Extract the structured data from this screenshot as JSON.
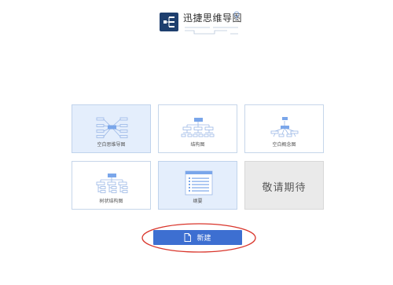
{
  "app": {
    "title": "迅捷思维导图"
  },
  "templates": [
    {
      "label": "空白思维导图",
      "icon": "mindmap-thumbnail-icon",
      "state": "selected"
    },
    {
      "label": "结构图",
      "icon": "structure-chart-thumbnail-icon",
      "state": "normal"
    },
    {
      "label": "空白概念图",
      "icon": "concept-map-thumbnail-icon",
      "state": "normal"
    },
    {
      "label": "树状结构图",
      "icon": "tree-chart-thumbnail-icon",
      "state": "normal"
    },
    {
      "label": "纲要",
      "icon": "outline-thumbnail-icon",
      "state": "selected"
    },
    {
      "label": "敬请期待",
      "icon": "",
      "state": "disabled"
    }
  ],
  "actions": {
    "new_label": "新建",
    "new_icon": "new-document-icon"
  },
  "colors": {
    "accent": "#3d6fd1",
    "logo": "#1e3f6e",
    "node": "#7aa6ea",
    "highlight_ellipse": "#d9352b",
    "selected_card": "#e4eefc"
  }
}
